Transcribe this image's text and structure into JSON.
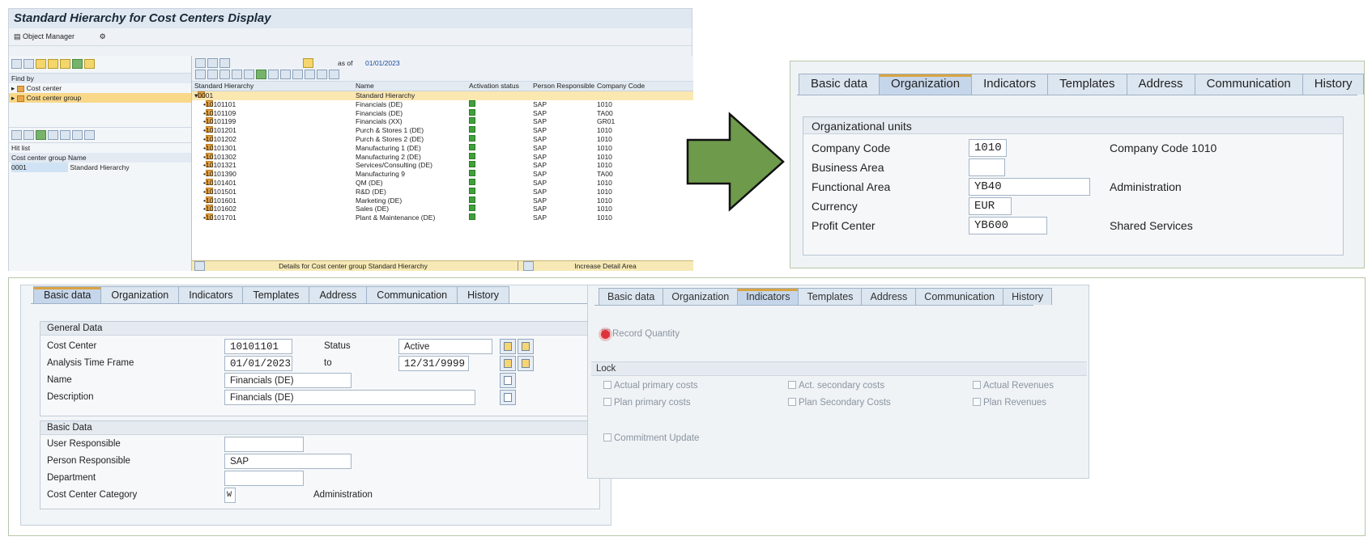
{
  "hierarchy_panel": {
    "title": "Standard Hierarchy for Cost Centers Display",
    "menu": {
      "object_manager": "Object Manager"
    },
    "find_by": {
      "label": "Find by",
      "items": [
        "Cost center",
        "Cost center group"
      ]
    },
    "hit_list": {
      "label": "Hit list",
      "headers": [
        "Cost center group",
        "Name"
      ],
      "row": [
        "0001",
        "Standard Hierarchy"
      ]
    },
    "as_of_label": "as of",
    "as_of_date": "01/01/2023",
    "columns": [
      "Standard Hierarchy",
      "Name",
      "Activation status",
      "Person Responsible",
      "Company Code"
    ],
    "top_node": {
      "id": "0001",
      "name": "Standard Hierarchy"
    },
    "rows": [
      {
        "id": "10101101",
        "name": "Financials (DE)",
        "person": "SAP",
        "company": "1010"
      },
      {
        "id": "10101109",
        "name": "Financials (DE)",
        "person": "SAP",
        "company": "TA00"
      },
      {
        "id": "10101199",
        "name": "Financials (XX)",
        "person": "SAP",
        "company": "GR01"
      },
      {
        "id": "10101201",
        "name": "Purch & Stores 1 (DE)",
        "person": "SAP",
        "company": "1010"
      },
      {
        "id": "10101202",
        "name": "Purch & Stores 2 (DE)",
        "person": "SAP",
        "company": "1010"
      },
      {
        "id": "10101301",
        "name": "Manufacturing 1 (DE)",
        "person": "SAP",
        "company": "1010"
      },
      {
        "id": "10101302",
        "name": "Manufacturing 2 (DE)",
        "person": "SAP",
        "company": "1010"
      },
      {
        "id": "10101321",
        "name": "Services/Consulting (DE)",
        "person": "SAP",
        "company": "1010"
      },
      {
        "id": "10101390",
        "name": "Manufacturing 9",
        "person": "SAP",
        "company": "TA00"
      },
      {
        "id": "10101401",
        "name": "QM (DE)",
        "person": "SAP",
        "company": "1010"
      },
      {
        "id": "10101501",
        "name": "R&D (DE)",
        "person": "SAP",
        "company": "1010"
      },
      {
        "id": "10101601",
        "name": "Marketing (DE)",
        "person": "SAP",
        "company": "1010"
      },
      {
        "id": "10101602",
        "name": "Sales (DE)",
        "person": "SAP",
        "company": "1010"
      },
      {
        "id": "10101701",
        "name": "Plant & Maintenance (DE)",
        "person": "SAP",
        "company": "1010"
      }
    ],
    "status_left": "Details for Cost center group Standard Hierarchy",
    "status_right": "Increase Detail Area"
  },
  "tabs": [
    "Basic data",
    "Organization",
    "Indicators",
    "Templates",
    "Address",
    "Communication",
    "History"
  ],
  "organization_panel": {
    "group_title": "Organizational units",
    "fields": {
      "company_code": {
        "label": "Company Code",
        "value": "1010",
        "desc": "Company Code 1010"
      },
      "business_area": {
        "label": "Business Area",
        "value": ""
      },
      "functional_area": {
        "label": "Functional Area",
        "value": "YB40",
        "desc": "Administration"
      },
      "currency": {
        "label": "Currency",
        "value": "EUR"
      },
      "profit_center": {
        "label": "Profit Center",
        "value": "YB600",
        "desc": "Shared Services"
      }
    }
  },
  "basic_panel": {
    "general_title": "General Data",
    "cost_center": {
      "label": "Cost Center",
      "value": "10101101"
    },
    "status": {
      "label": "Status",
      "value": "Active"
    },
    "time_frame": {
      "label": "Analysis Time Frame",
      "from": "01/01/2023",
      "to_label": "to",
      "to": "12/31/9999"
    },
    "name": {
      "label": "Name",
      "value": "Financials (DE)"
    },
    "description": {
      "label": "Description",
      "value": "Financials (DE)"
    },
    "basic_title": "Basic Data",
    "user_responsible": {
      "label": "User Responsible",
      "value": ""
    },
    "person_responsible": {
      "label": "Person Responsible",
      "value": "SAP"
    },
    "department": {
      "label": "Department",
      "value": ""
    },
    "category": {
      "label": "Cost Center Category",
      "value": "W",
      "desc": "Administration"
    }
  },
  "indicators_panel": {
    "record_quantity": "Record Quantity",
    "lock_title": "Lock",
    "locks": [
      "Actual primary costs",
      "Act. secondary costs",
      "Actual Revenues",
      "Plan primary costs",
      "Plan Secondary Costs",
      "Plan Revenues"
    ],
    "commitment_update": "Commitment Update"
  },
  "colors": {
    "arrow": "#6e9a4b",
    "active_tab_accent": "#d9a441",
    "status_green": "#3fa13a"
  }
}
